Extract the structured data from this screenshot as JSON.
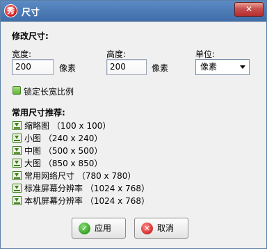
{
  "window": {
    "title": "尺寸",
    "app_icon_glyph": "秀",
    "close_glyph": "✕"
  },
  "modify_size": {
    "heading": "修改尺寸:",
    "width_label": "宽度:",
    "width_value": "200",
    "height_label": "高度:",
    "height_value": "200",
    "unit_text": "像素",
    "unit_label": "单位:",
    "unit_selected": "像素"
  },
  "lock_ratio": {
    "label": "锁定长宽比例",
    "checked": true,
    "accent": "#63b335"
  },
  "presets": {
    "heading": "常用尺寸推荐:",
    "items": [
      {
        "label": "缩略图 （100 x 100）"
      },
      {
        "label": "小图 （240 x 240）"
      },
      {
        "label": "中图 （500 x 500）"
      },
      {
        "label": "大图 （850 x 850）"
      },
      {
        "label": "常用网络尺寸 （780 x 780）"
      },
      {
        "label": "标准屏幕分辨率 （1024 x 768）"
      },
      {
        "label": "本机屏幕分辨率 （1024 x 768）"
      }
    ],
    "icon": "preset-size-icon"
  },
  "buttons": {
    "ok_label": "应用",
    "ok_glyph": "✓",
    "cancel_label": "取消",
    "cancel_glyph": "✕"
  }
}
